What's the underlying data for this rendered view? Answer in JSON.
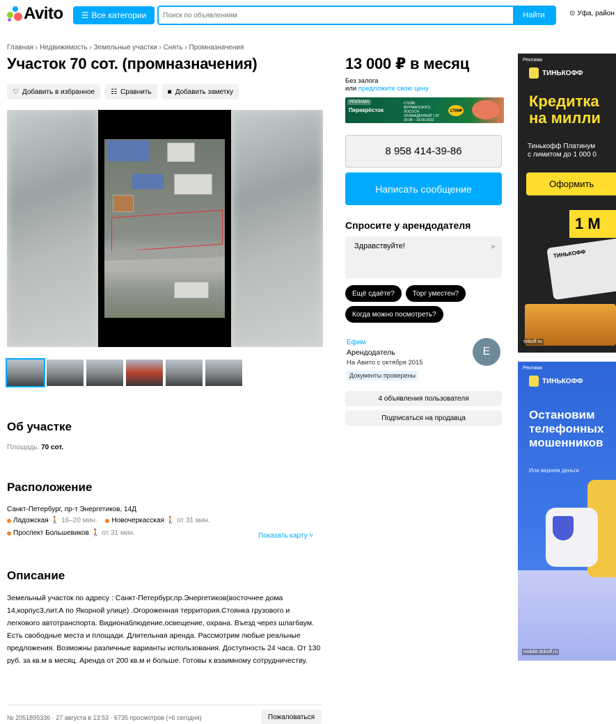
{
  "header": {
    "logo": "Avito",
    "categories_label": "Все категории",
    "search_placeholder": "Поиск по объявлениям",
    "search_button": "Найти",
    "location": "Уфа, район"
  },
  "breadcrumb": "Главная › Недвижимость › Земельные участки › Снять › Промназначения",
  "title": "Участок 70 сот. (промназначения)",
  "actions": {
    "favorite": "Добавить в избранное",
    "compare": "Сравнить",
    "note": "Добавить заметку"
  },
  "gallery": {
    "thumbnail_count": 6
  },
  "about": {
    "heading": "Об участке",
    "area_label": "Площадь:",
    "area_value": "70 сот."
  },
  "location": {
    "heading": "Расположение",
    "address": "Санкт-Петербург, пр-т Энергетиков, 14Д",
    "metro": [
      {
        "name": "Ладожская",
        "time": "16–20 мин."
      },
      {
        "name": "Новочеркасская",
        "time": "от 31 мин."
      },
      {
        "name": "Проспект Большевиков",
        "time": "от 31 мин."
      }
    ],
    "metro_color": "#f68422",
    "show_map": "Показать карту"
  },
  "description": {
    "heading": "Описание",
    "text": "Земельный участок по адресу : Санкт-Петербург,пр.Энергетиков(восточнее дома 14,корпус3,лит.А по Якорной улице) .Огороженная территория.Стоянка грузового и легкового автотранспорта. Видионаблюдение,освещение, охрана. Въезд через шлагбаум. Есть свободные места и площади. Длительная аренда. Рассмотрим любые реальные предложения. Возможны различные варианты использования. Доступность 24 часа. От 130 руб. за кв.м в месяц. Аренда от 200 кв.м и больше. Готовы к взаимному сотрудничеству."
  },
  "footer": {
    "meta": "№ 2051895336 · 27 августа в 13:53 · 6735 просмотров (+6 сегодня)",
    "complain": "Пожаловаться"
  },
  "offer": {
    "price": "13 000 ₽ в месяц",
    "deposit": "Без залога",
    "suggest_prefix": "или",
    "suggest_link": "предложите свою цену"
  },
  "promo": {
    "badge": "РЕКЛАМА",
    "brand": "Перекрёсток",
    "text": "СТЕЙК МУРМАНСКОГО ЛОСОСЯ ОХЛАЖДЁННЫЙ 1 КГ 29.08 – 18.09.2023",
    "price": "1799₽"
  },
  "contact": {
    "phone": "8 958 414-39-86",
    "message_button": "Написать сообщение"
  },
  "ask": {
    "heading": "Спросите у арендодателя",
    "input_value": "Здравствуйте!",
    "chips": [
      "Ещё сдаёте?",
      "Торг уместен?",
      "Когда можно посмотреть?"
    ]
  },
  "seller": {
    "name": "Ефим",
    "role": "Арендодатель",
    "since": "На Авито с октября 2015",
    "badge": "Документы проверены",
    "avatar_letter": "Е",
    "listings_button": "4 объявления пользователя",
    "subscribe_button": "Подписаться на продавца"
  },
  "ads": {
    "label": "Реклама",
    "ad1": {
      "brand": "ТИНЬКОФФ",
      "head_line1": "Кредитка",
      "head_line2": "на милли",
      "sub_line1": "Тинькофф Платинум",
      "sub_line2": "с лимитом до 1 000 0",
      "cta": "Оформить",
      "big_text": "1 М",
      "card_text": "ТИНЬКОФФ",
      "domain": "tinkoff.ru"
    },
    "ad2": {
      "brand": "ТИНЬКОФФ",
      "head_line1": "Остановим",
      "head_line2": "телефонных",
      "head_line3": "мошенников",
      "sub": "Или вернем деньги",
      "domain": "mobile.tinkoff.ru"
    }
  }
}
